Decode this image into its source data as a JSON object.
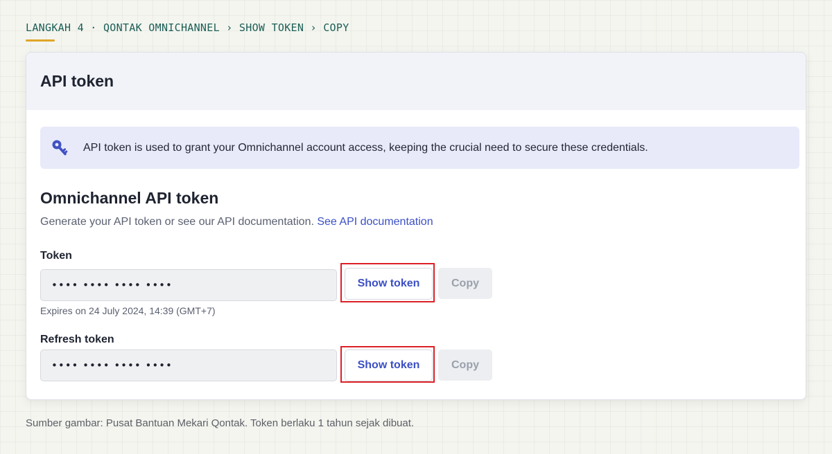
{
  "step": {
    "label": "LANGKAH 4 · QONTAK OMNICHANNEL › SHOW TOKEN › COPY"
  },
  "card": {
    "title": "API token",
    "info_banner": {
      "icon": "key-icon",
      "text": "API token is used to grant your Omnichannel account access, keeping the crucial need to secure these credentials."
    },
    "section": {
      "title": "Omnichannel API token",
      "description": "Generate your API token or see our API documentation.",
      "link_label": "See API documentation"
    },
    "token": {
      "label": "Token",
      "masked_value": "•••• •••• •••• ••••",
      "show_label": "Show token",
      "copy_label": "Copy",
      "expires": "Expires on 24 July 2024, 14:39 (GMT+7)"
    },
    "refresh_token": {
      "label": "Refresh token",
      "masked_value": "•••• •••• •••• ••••",
      "show_label": "Show token",
      "copy_label": "Copy"
    }
  },
  "colors": {
    "accent_link": "#3b4fc4",
    "highlight": "#dc1f26",
    "step_text": "#1b5e56",
    "step_underline": "#e0a526"
  },
  "caption": "Sumber gambar: Pusat Bantuan Mekari Qontak. Token berlaku 1 tahun sejak dibuat."
}
